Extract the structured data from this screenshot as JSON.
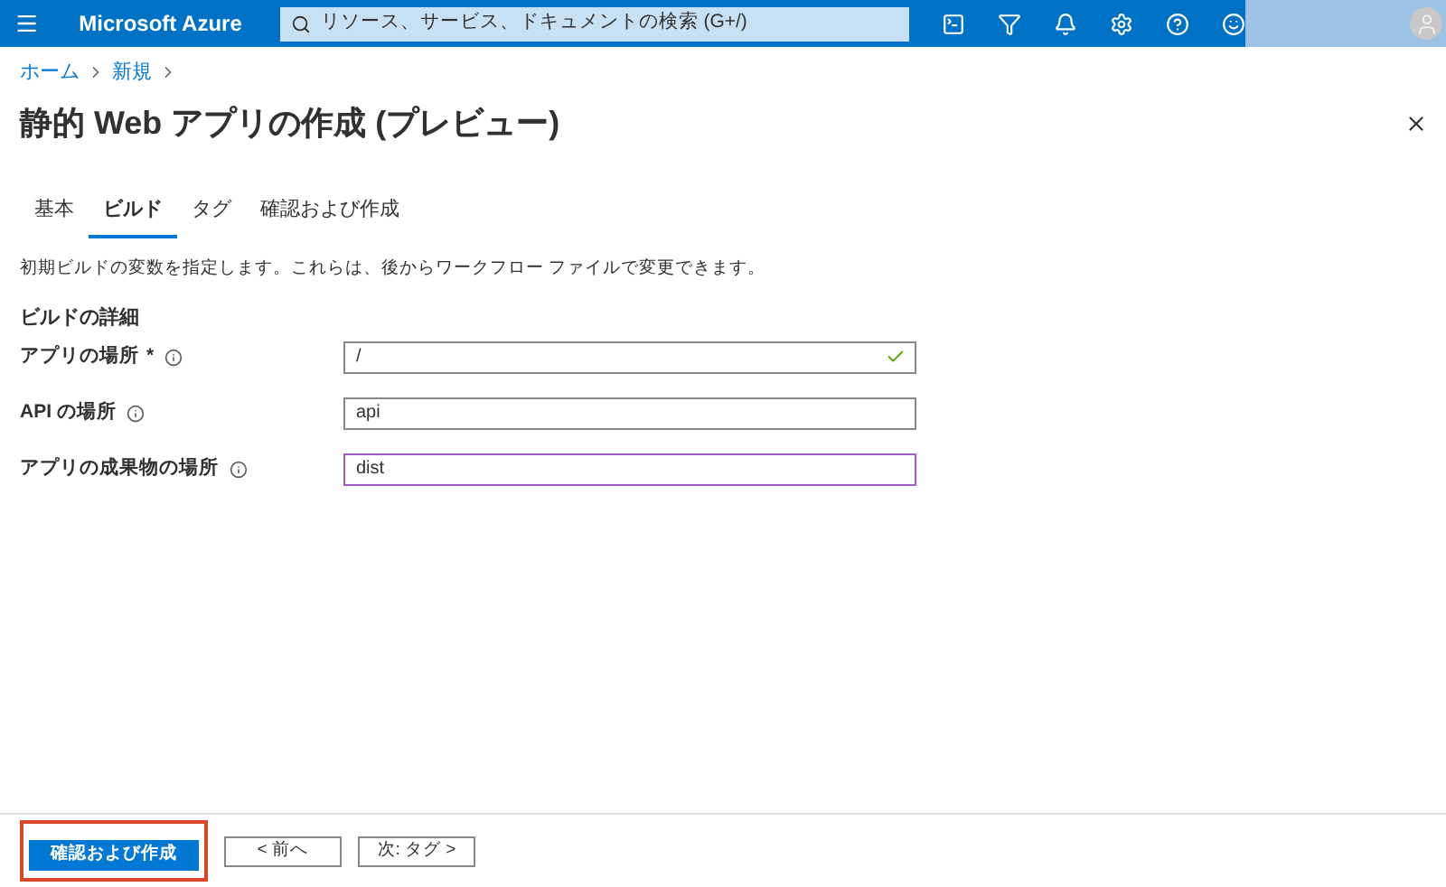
{
  "topbar": {
    "brand": "Microsoft Azure",
    "search": {
      "placeholder": "リソース、サービス、ドキュメントの検索 (G+/)"
    }
  },
  "breadcrumb": [
    "ホーム",
    "新規"
  ],
  "title": "静的 Web アプリの作成 (プレビュー)",
  "tabs": [
    {
      "label": "基本",
      "selected": false
    },
    {
      "label": "ビルド",
      "selected": true
    },
    {
      "label": "タグ",
      "selected": false
    },
    {
      "label": "確認および作成",
      "selected": false
    }
  ],
  "description": "初期ビルドの変数を指定します。これらは、後からワークフロー ファイルで変更できます。",
  "section": "ビルドの詳細",
  "fields": [
    {
      "label": "アプリの場所",
      "required": "*",
      "value": "/",
      "valid": true,
      "focused": false
    },
    {
      "label": "API の場所",
      "value": "api",
      "valid": false,
      "focused": false
    },
    {
      "label": "アプリの成果物の場所",
      "value": "dist",
      "valid": false,
      "focused": true
    }
  ],
  "buttons": [
    {
      "label": "確認および作成",
      "kind": "primary",
      "highlighted": true
    },
    {
      "label": "< 前へ",
      "kind": "secondary",
      "highlighted": false
    },
    {
      "label": "次: タグ >",
      "kind": "secondary",
      "highlighted": false
    }
  ]
}
